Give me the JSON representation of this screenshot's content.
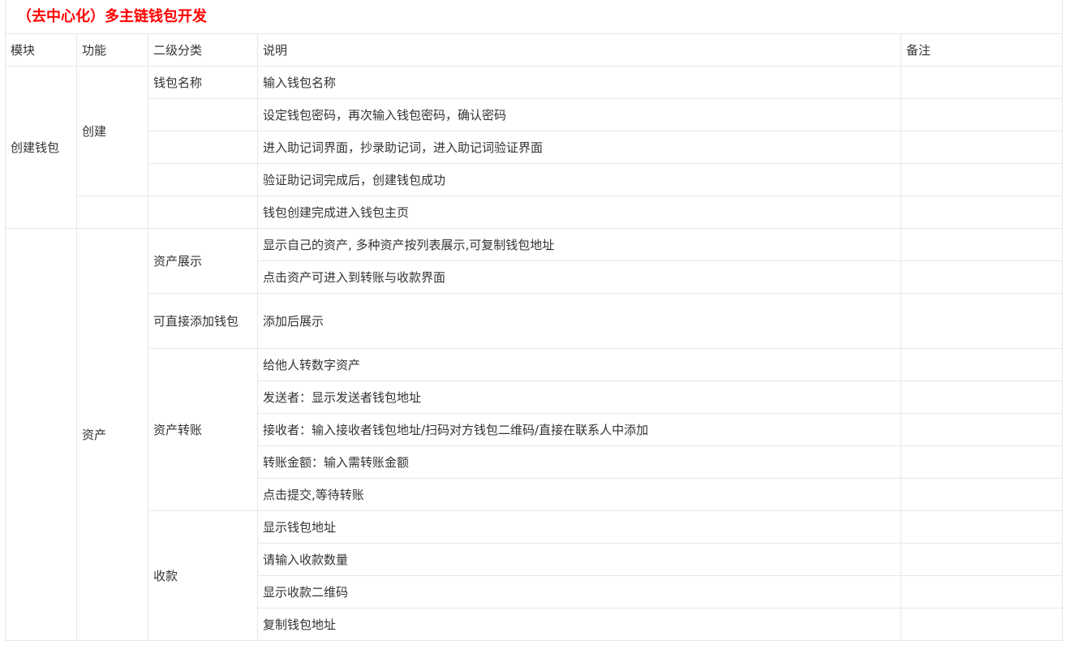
{
  "title": "（去中心化）多主链钱包开发",
  "headers": {
    "module": "模块",
    "function": "功能",
    "subcategory": "二级分类",
    "description": "说明",
    "remark": "备注"
  },
  "sections": {
    "create_wallet": {
      "module": "创建钱包",
      "function": "创建",
      "name_sub": "钱包名称",
      "rows": [
        "输入钱包名称",
        "设定钱包密码，再次输入钱包密码，确认密码",
        "进入助记词界面，抄录助记词，进入助记词验证界面",
        "验证助记词完成后，创建钱包成功",
        "钱包创建完成进入钱包主页"
      ]
    },
    "assets": {
      "function": "资产",
      "display_sub": "资产展示",
      "display_rows": [
        "显示自己的资产, 多种资产按列表展示,可复制钱包地址",
        "点击资产可进入到转账与收款界面"
      ],
      "add_sub": "可直接添加钱包",
      "add_desc": "添加后展示",
      "transfer_sub": "资产转账",
      "transfer_rows": [
        "给他人转数字资产",
        "发送者：显示发送者钱包地址",
        "接收者：输入接收者钱包地址/扫码对方钱包二维码/直接在联系人中添加",
        "转账金额：输入需转账金额",
        "点击提交,等待转账"
      ],
      "receive_sub": "收款",
      "receive_rows": [
        "显示钱包地址",
        "请输入收款数量",
        "显示收款二维码",
        "复制钱包地址"
      ]
    }
  }
}
